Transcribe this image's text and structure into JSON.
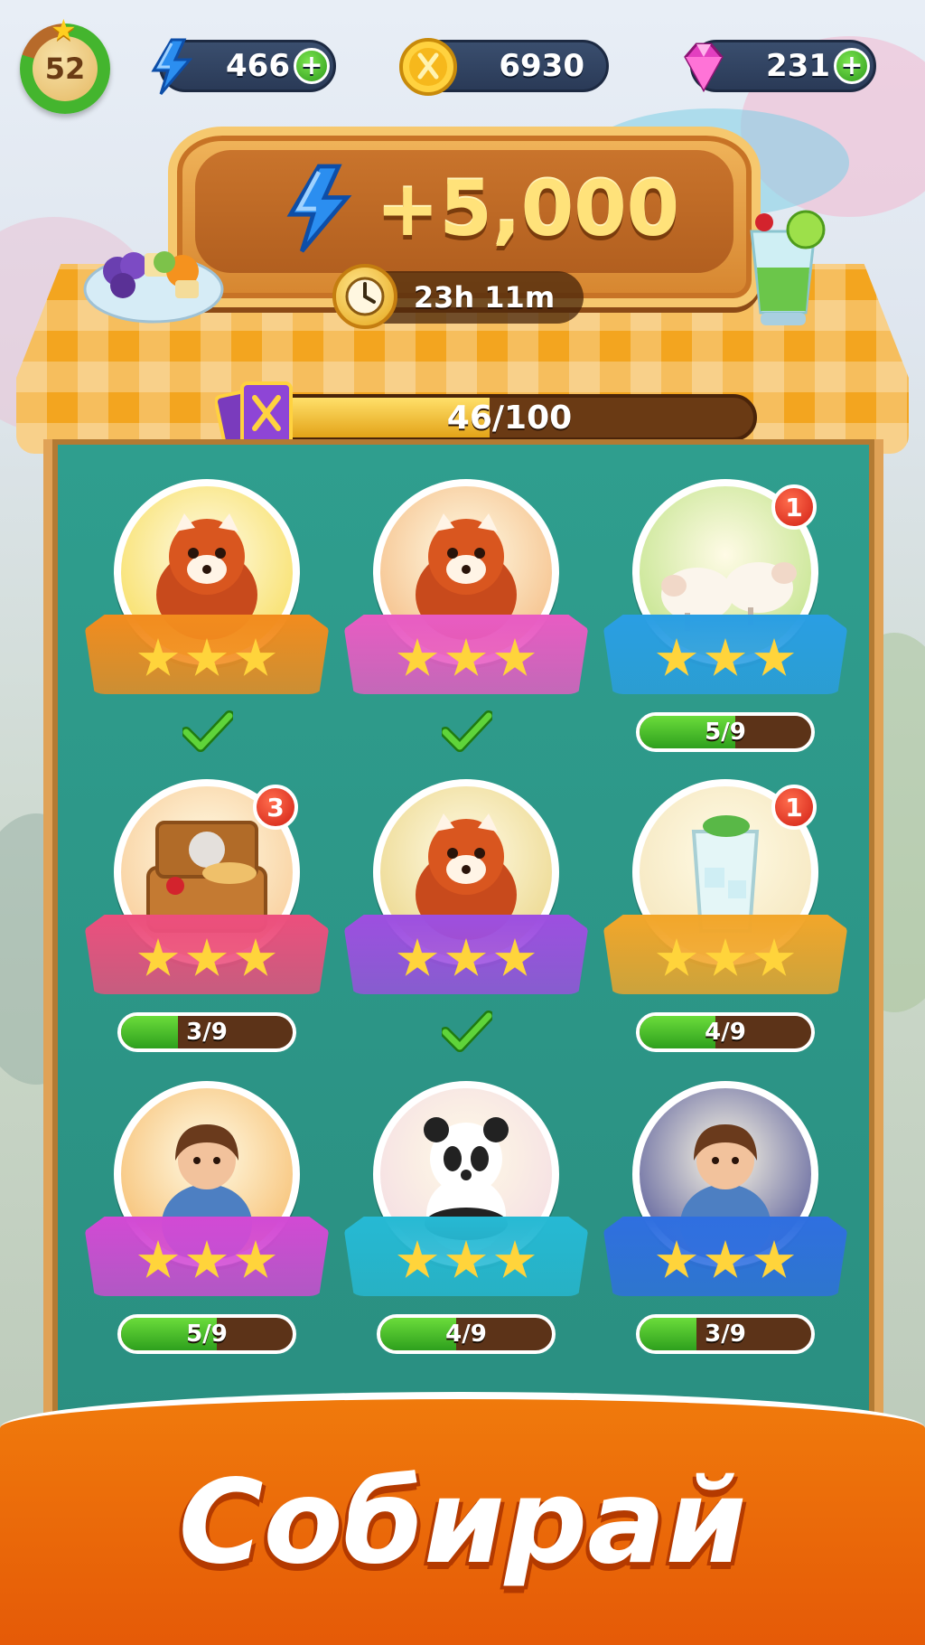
{
  "hud": {
    "level": "52",
    "energy": "466",
    "coins": "6930",
    "gems": "231"
  },
  "event": {
    "reward": "+5,000",
    "timer": "23h 11m",
    "progress_text": "46/100",
    "progress": 0.46
  },
  "items": [
    {
      "name": "red-panda-flowers",
      "stars": 3,
      "status": "complete",
      "badge": null,
      "theme": "#f28c1e",
      "disc": "#f6d94a",
      "subject": "red-panda"
    },
    {
      "name": "red-panda-apron",
      "stars": 3,
      "status": "complete",
      "badge": null,
      "theme": "#e85cc3",
      "disc": "#f3b274",
      "subject": "red-panda"
    },
    {
      "name": "sheep-meadow",
      "stars": 3,
      "status": "progress",
      "progress_text": "5/9",
      "progress": 0.556,
      "badge": "1",
      "theme": "#2a9ee3",
      "disc": "#b7df7a",
      "subject": "sheep"
    },
    {
      "name": "picnic-basket",
      "stars": 3,
      "status": "progress",
      "progress_text": "3/9",
      "progress": 0.333,
      "badge": "3",
      "theme": "#ec4f7d",
      "disc": "#f7c48a",
      "subject": "basket"
    },
    {
      "name": "red-panda-leprechaun",
      "stars": 3,
      "status": "complete",
      "badge": null,
      "theme": "#9d4fe0",
      "disc": "#e8d07a",
      "subject": "red-panda"
    },
    {
      "name": "mint-lemonade",
      "stars": 3,
      "status": "progress",
      "progress_text": "4/9",
      "progress": 0.444,
      "badge": "1",
      "theme": "#f2a62a",
      "disc": "#f3e2b6",
      "subject": "glass"
    },
    {
      "name": "guitar-girl",
      "stars": 3,
      "status": "progress",
      "progress_text": "5/9",
      "progress": 0.556,
      "badge": null,
      "theme": "#d24ad4",
      "disc": "#f5b35a",
      "subject": "girl"
    },
    {
      "name": "panda",
      "stars": 3,
      "status": "progress",
      "progress_text": "4/9",
      "progress": 0.444,
      "badge": null,
      "theme": "#26b9d4",
      "disc": "#f2d7e2",
      "subject": "panda"
    },
    {
      "name": "night-market-girl",
      "stars": 3,
      "status": "progress",
      "progress_text": "3/9",
      "progress": 0.333,
      "badge": null,
      "theme": "#2f6fe0",
      "disc": "#3a3f8c",
      "subject": "girl"
    }
  ],
  "banner": {
    "text": "Собирай"
  }
}
